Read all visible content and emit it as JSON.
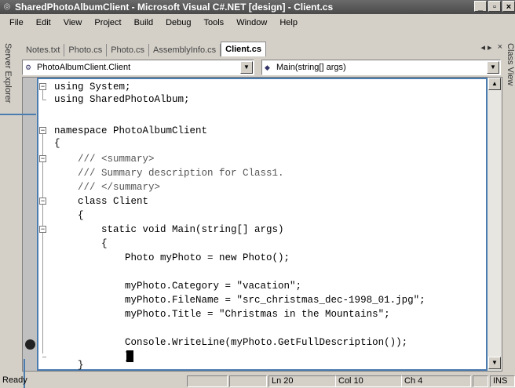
{
  "titlebar": {
    "title": "SharedPhotoAlbumClient - Microsoft Visual C#.NET [design] - Client.cs",
    "minimize": "_",
    "maximize": "▫",
    "close": "×"
  },
  "menu": [
    "File",
    "Edit",
    "View",
    "Project",
    "Build",
    "Debug",
    "Tools",
    "Window",
    "Help"
  ],
  "side_panels": {
    "left": "Server Explorer",
    "right": "Class View"
  },
  "tabs": [
    "Notes.txt",
    "Photo.cs",
    "Photo.cs",
    "AssemblyInfo.cs",
    "Client.cs"
  ],
  "active_tab": "Client.cs",
  "tab_nav": {
    "prev": "◂",
    "next": "▸",
    "close": "×"
  },
  "navbar": {
    "class_combo": "PhotoAlbumClient.Client",
    "member_combo": "Main(string[] args)"
  },
  "code_lines": [
    "using System;",
    "using SharedPhotoAlbum;",
    "",
    "namespace PhotoAlbumClient",
    "{",
    "    /// <summary>",
    "    /// Summary description for Class1.",
    "    /// </summary>",
    "    class Client",
    "    {",
    "        static void Main(string[] args)",
    "        {",
    "            Photo myPhoto = new Photo();",
    "",
    "            myPhoto.Category = \"vacation\";",
    "            myPhoto.FileName = \"src_christmas_dec-1998_01.jpg\";",
    "            myPhoto.Title = \"Christmas in the Mountains\";",
    "",
    "            Console.WriteLine(myPhoto.GetFullDescription());",
    "            }",
    "    }"
  ],
  "status": {
    "ready": "Ready",
    "line": "Ln 20",
    "col": "Col 10",
    "ch": "Ch 4",
    "mode": "INS"
  }
}
